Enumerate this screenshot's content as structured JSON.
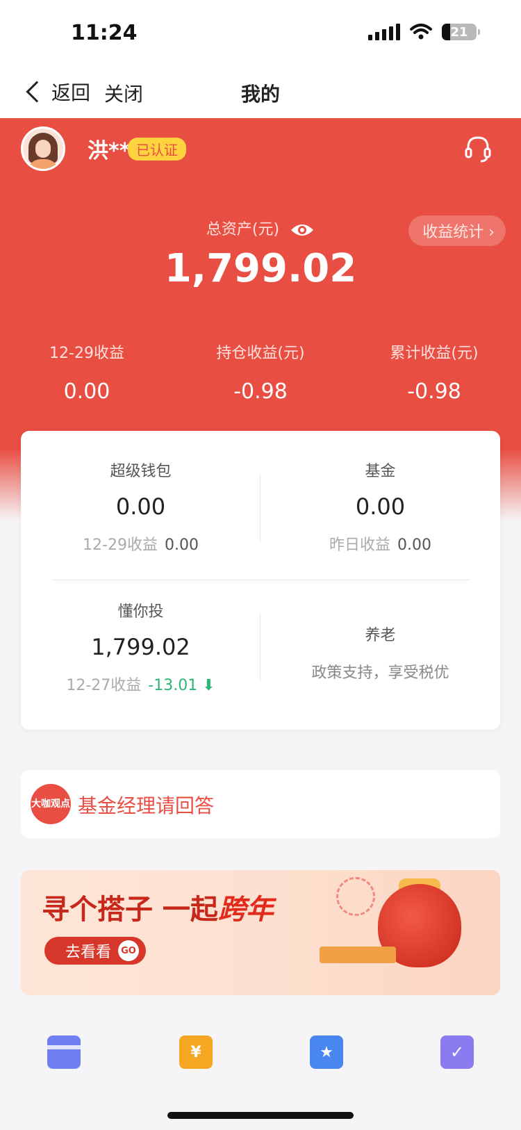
{
  "status_bar": {
    "time": "11:24",
    "battery": "21"
  },
  "nav": {
    "back_label": "返回",
    "close_label": "关闭",
    "title": "我的"
  },
  "user": {
    "name": "洪**",
    "badge": "已认证"
  },
  "assets": {
    "total_label": "总资产(元)",
    "total_value": "1,799.02",
    "stats_button": "收益统计 ›",
    "metrics": [
      {
        "label": "12-29收益",
        "value": "0.00"
      },
      {
        "label": "持仓收益(元)",
        "value": "-0.98"
      },
      {
        "label": "累计收益(元)",
        "value": "-0.98"
      }
    ]
  },
  "products": {
    "super_wallet": {
      "title": "超级钱包",
      "value": "0.00",
      "sub_label": "12-29收益",
      "sub_value": "0.00"
    },
    "fund": {
      "title": "基金",
      "value": "0.00",
      "sub_label": "昨日收益",
      "sub_value": "0.00"
    },
    "dongnitou": {
      "title": "懂你投",
      "value": "1,799.02",
      "sub_label": "12-27收益",
      "sub_value": "-13.01"
    },
    "pension": {
      "title": "养老",
      "desc": "政策支持，享受税优"
    }
  },
  "qa": {
    "badge": "大咖观点",
    "text": "基金经理请回答"
  },
  "banner": {
    "title_main": "寻个搭子 一起",
    "title_accent": "跨年",
    "button": "去看看",
    "go": "GO"
  },
  "bottom_icons": [
    "card-icon",
    "yen-coupon-icon",
    "info-doc-icon",
    "checklist-icon"
  ],
  "colors": {
    "brand_red": "#e94e43",
    "badge_yellow": "#ffd23f",
    "loss_green": "#2bb673"
  }
}
